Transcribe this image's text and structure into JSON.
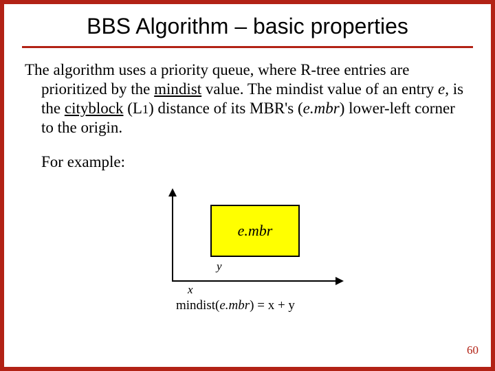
{
  "title": "BBS Algorithm – basic properties",
  "p1a": "The algorithm uses a priority queue, where R-tree entries are prioritized by the ",
  "mindist": "mindist",
  "p1b": " value. The mindist value of an entry ",
  "e_it": "e, ",
  "p1c": "is the ",
  "cityblock": "cityblock",
  "p1d": " (L",
  "L1": "1",
  "p1e": ") distance of its MBR's (",
  "embr": "e.mbr",
  "p1f": ") lower-left corner to the origin.",
  "for_example": "For example:",
  "fig": {
    "mbr_label": "e.mbr",
    "y": "y",
    "x": "x",
    "formula_a": "mindist(",
    "formula_b": "e.mbr",
    "formula_c": ") = x + y"
  },
  "page": "60",
  "chart_data": {
    "type": "line",
    "title": "mindist diagram",
    "xlabel": "x",
    "ylabel": "y",
    "annotation": "mindist(e.mbr) = x + y",
    "categories": [],
    "values": []
  }
}
